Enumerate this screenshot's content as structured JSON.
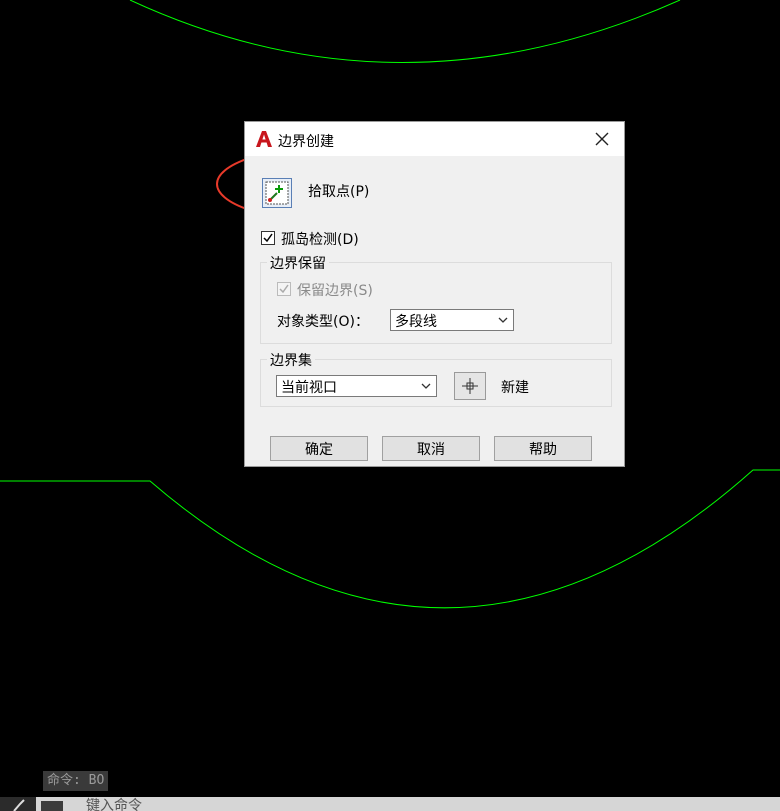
{
  "dialog": {
    "title": "边界创建",
    "pick_points_label": "拾取点(P)",
    "island_detection_label": "孤岛检测(D)",
    "island_detection_checked": true,
    "boundary_retention": {
      "legend": "边界保留",
      "retain_label": "保留边界(S)",
      "retain_checked": true,
      "retain_disabled": true,
      "object_type_label": "对象类型(O)：",
      "object_type_value": "多段线"
    },
    "boundary_set": {
      "legend": "边界集",
      "value": "当前视口",
      "new_label": "新建"
    },
    "buttons": {
      "ok": "确定",
      "cancel": "取消",
      "help": "帮助"
    }
  },
  "command_line": {
    "history": "命令: BO",
    "input_placeholder": "键入命令"
  },
  "colors": {
    "background": "#000000",
    "geometry_line": "#00ff00",
    "annotation_ellipse": "#e83a2a",
    "dialog_bg": "#f0f0f0",
    "app_icon_red": "#c8161d"
  },
  "icons": [
    "autocad-app-icon",
    "close-icon",
    "pick-points-icon",
    "chevron-down-icon",
    "crosshair-icon",
    "wrench-icon",
    "terminal-icon"
  ]
}
